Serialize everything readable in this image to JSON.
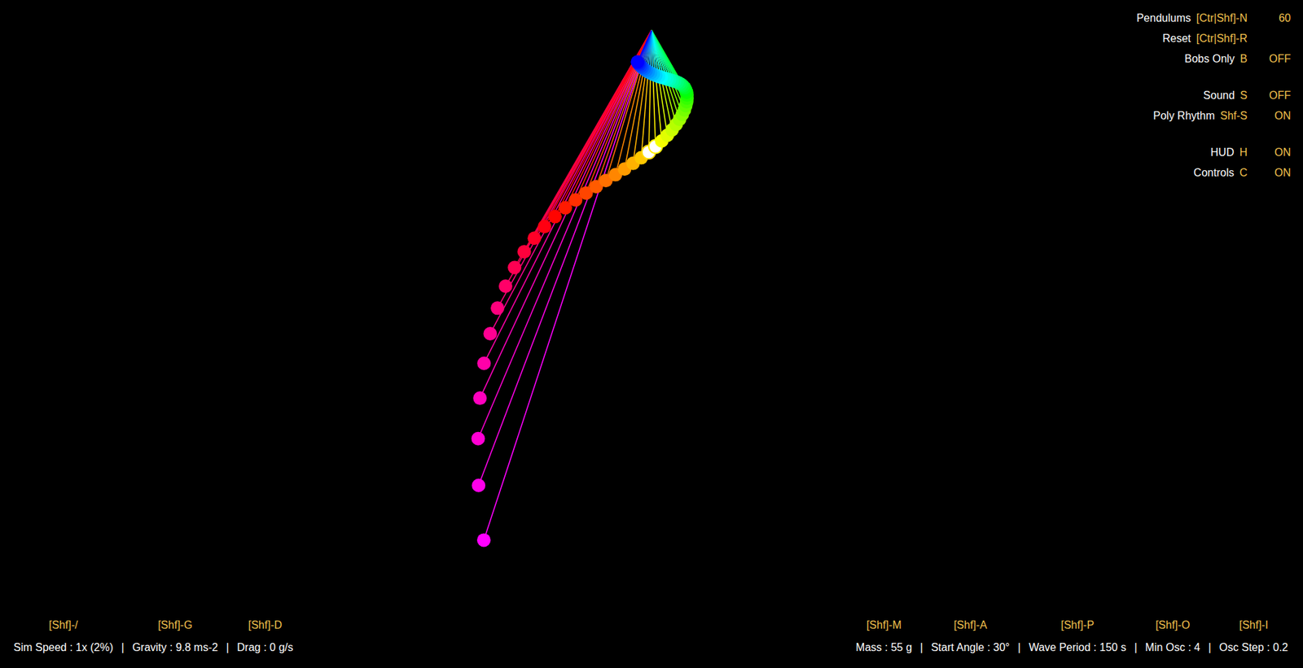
{
  "hud": {
    "groups": [
      [
        {
          "label": "Pendulums",
          "key": "[Ctr|Shf]-N",
          "value": "60"
        },
        {
          "label": "Reset",
          "key": "[Ctr|Shf]-R"
        },
        {
          "label": "Bobs Only",
          "key": "B",
          "value": "OFF"
        }
      ],
      [
        {
          "label": "Sound",
          "key": "S",
          "value": "OFF"
        },
        {
          "label": "Poly Rhythm",
          "key": "Shf-S",
          "value": "ON"
        }
      ],
      [
        {
          "label": "HUD",
          "key": "H",
          "value": "ON"
        },
        {
          "label": "Controls",
          "key": "C",
          "value": "ON"
        }
      ]
    ]
  },
  "controls": {
    "separator": "|",
    "left": [
      {
        "key": "[Shf]-/",
        "label": "Sim Speed : 1x (2%)"
      },
      {
        "key": "[Shf]-G",
        "label": "Gravity : 9.8 ms-2"
      },
      {
        "key": "[Shf]-D",
        "label": "Drag : 0 g/s"
      }
    ],
    "right": [
      {
        "key": "[Shf]-M",
        "label": "Mass : 55 g"
      },
      {
        "key": "[Shf]-A",
        "label": "Start Angle : 30°"
      },
      {
        "key": "[Shf]-P",
        "label": "Wave Period : 150 s"
      },
      {
        "key": "[Shf]-O",
        "label": "Min Osc : 4"
      },
      {
        "key": "[Shf]-I",
        "label": "Osc Step : 0.2"
      }
    ]
  },
  "pendulums": [
    {
      "angle": -18.2,
      "color": "#ff00ff",
      "highlighted": false
    },
    {
      "angle": -20.8,
      "color": "#ff00e9",
      "highlighted": false
    },
    {
      "angle": -23.0,
      "color": "#ff00d4",
      "highlighted": false
    },
    {
      "angle": -25.0,
      "color": "#ff00be",
      "highlighted": false
    },
    {
      "angle": -26.7,
      "color": "#ff00a9",
      "highlighted": false
    },
    {
      "angle": -28.0,
      "color": "#ff0093",
      "highlighted": false
    },
    {
      "angle": -29.0,
      "color": "#ff007d",
      "highlighted": false
    },
    {
      "angle": -29.7,
      "color": "#ff0068",
      "highlighted": false
    },
    {
      "angle": -30.0,
      "color": "#ff0052",
      "highlighted": false
    },
    {
      "angle": -29.9,
      "color": "#ff003c",
      "highlighted": false
    },
    {
      "angle": -29.4,
      "color": "#ff0027",
      "highlighted": false
    },
    {
      "angle": -28.6,
      "color": "#ff0011",
      "highlighted": false
    },
    {
      "angle": -27.4,
      "color": "#ff0400",
      "highlighted": false
    },
    {
      "angle": -25.9,
      "color": "#ff1a00",
      "highlighted": false
    },
    {
      "angle": -24.1,
      "color": "#ff3000",
      "highlighted": false
    },
    {
      "angle": -21.9,
      "color": "#ff4500",
      "highlighted": false
    },
    {
      "angle": -19.5,
      "color": "#ff5b00",
      "highlighted": false
    },
    {
      "angle": -16.9,
      "color": "#ff7000",
      "highlighted": false
    },
    {
      "angle": -14.0,
      "color": "#ff8600",
      "highlighted": false
    },
    {
      "angle": -11.0,
      "color": "#ff9c00",
      "highlighted": false
    },
    {
      "angle": -7.9,
      "color": "#ffb100",
      "highlighted": false
    },
    {
      "angle": -4.6,
      "color": "#ffc700",
      "highlighted": false
    },
    {
      "angle": -1.3,
      "color": "#ffdc00",
      "highlighted": true
    },
    {
      "angle": 2.0,
      "color": "#fff200",
      "highlighted": true
    },
    {
      "angle": 5.3,
      "color": "#f6ff00",
      "highlighted": false
    },
    {
      "angle": 8.6,
      "color": "#e1ff00",
      "highlighted": false
    },
    {
      "angle": 11.7,
      "color": "#cbff00",
      "highlighted": false
    },
    {
      "angle": 14.7,
      "color": "#b6ff00",
      "highlighted": false
    },
    {
      "angle": 17.5,
      "color": "#a0ff00",
      "highlighted": false
    },
    {
      "angle": 20.1,
      "color": "#8aff00",
      "highlighted": false
    },
    {
      "angle": 22.5,
      "color": "#75ff00",
      "highlighted": false
    },
    {
      "angle": 24.5,
      "color": "#5fff00",
      "highlighted": false
    },
    {
      "angle": 26.3,
      "color": "#49ff00",
      "highlighted": false
    },
    {
      "angle": 27.7,
      "color": "#34ff00",
      "highlighted": false
    },
    {
      "angle": 28.8,
      "color": "#1eff00",
      "highlighted": false
    },
    {
      "angle": 29.6,
      "color": "#09ff00",
      "highlighted": false
    },
    {
      "angle": 29.9,
      "color": "#00ff0d",
      "highlighted": false
    },
    {
      "angle": 30.0,
      "color": "#00ff23",
      "highlighted": false
    },
    {
      "angle": 29.6,
      "color": "#00ff38",
      "highlighted": false
    },
    {
      "angle": 28.9,
      "color": "#00ff4e",
      "highlighted": false
    },
    {
      "angle": 27.8,
      "color": "#00ff63",
      "highlighted": false
    },
    {
      "angle": 26.4,
      "color": "#00ff79",
      "highlighted": false
    },
    {
      "angle": 24.6,
      "color": "#00ff8f",
      "highlighted": false
    },
    {
      "angle": 22.5,
      "color": "#00ffa4",
      "highlighted": false
    },
    {
      "angle": 20.2,
      "color": "#00ffba",
      "highlighted": false
    },
    {
      "angle": 17.7,
      "color": "#00ffcf",
      "highlighted": false
    },
    {
      "angle": 14.8,
      "color": "#00ffe5",
      "highlighted": false
    },
    {
      "angle": 11.9,
      "color": "#00fffb",
      "highlighted": false
    },
    {
      "angle": 8.7,
      "color": "#00eeff",
      "highlighted": false
    },
    {
      "angle": 5.5,
      "color": "#00d8ff",
      "highlighted": false
    },
    {
      "angle": 2.2,
      "color": "#00c2ff",
      "highlighted": false
    },
    {
      "angle": -1.2,
      "color": "#00adff",
      "highlighted": false
    },
    {
      "angle": -4.5,
      "color": "#0097ff",
      "highlighted": false
    },
    {
      "angle": -7.7,
      "color": "#0082ff",
      "highlighted": false
    },
    {
      "angle": -10.9,
      "color": "#006cff",
      "highlighted": false
    },
    {
      "angle": -13.9,
      "color": "#0056ff",
      "highlighted": false
    },
    {
      "angle": -16.8,
      "color": "#0041ff",
      "highlighted": false
    },
    {
      "angle": -19.5,
      "color": "#002bff",
      "highlighted": false
    },
    {
      "angle": -21.9,
      "color": "#0016ff",
      "highlighted": false
    },
    {
      "angle": -24.0,
      "color": "#0000ff",
      "highlighted": false
    }
  ]
}
